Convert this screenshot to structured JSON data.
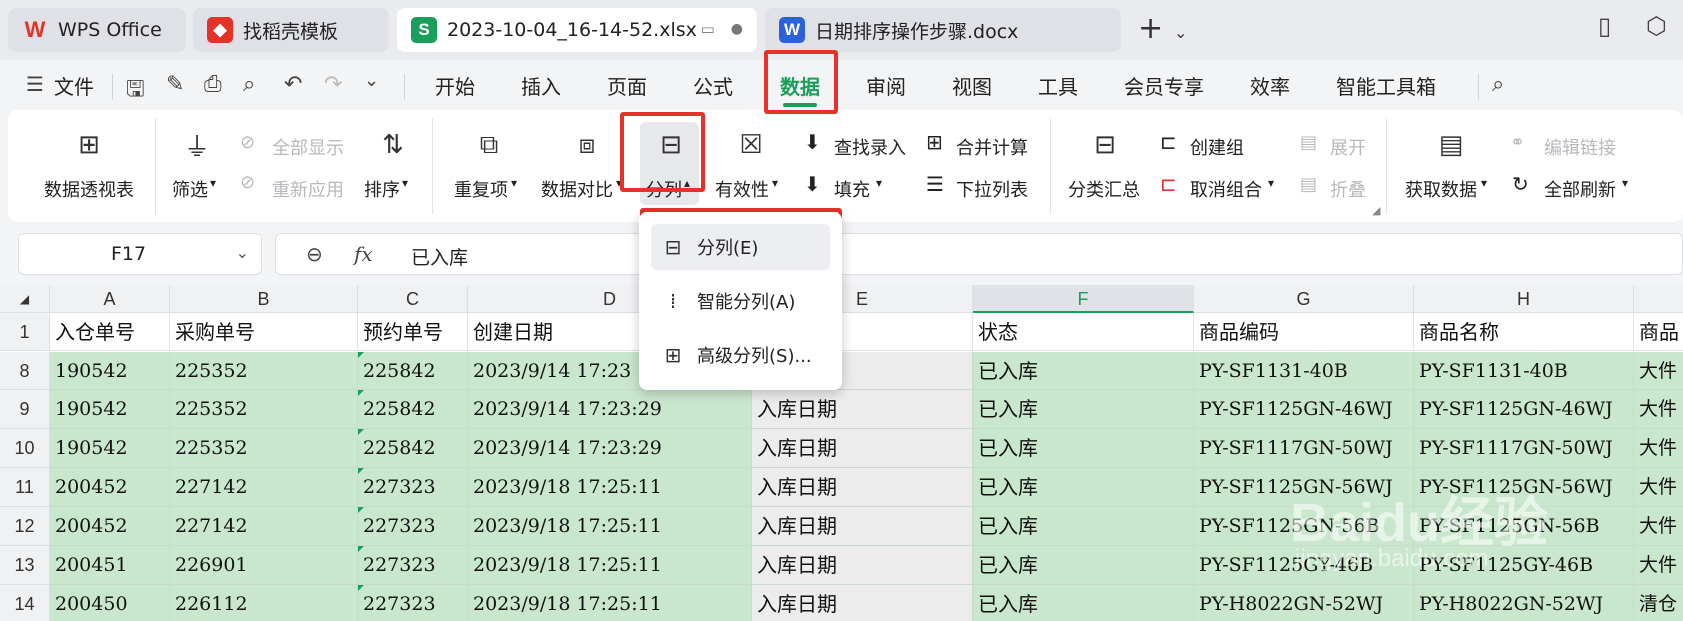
{
  "tabs": [
    {
      "label": "WPS Office",
      "icon": "wps-logo-icon"
    },
    {
      "label": "找稻壳模板",
      "icon": "docer-icon"
    },
    {
      "label": "2023-10-04_16-14-52.xlsx",
      "icon": "spreadsheet-icon",
      "icon_text": "S"
    },
    {
      "label": "日期排序操作步骤.docx",
      "icon": "writer-icon",
      "icon_text": "W"
    }
  ],
  "menu": {
    "file": "文件",
    "items": [
      "开始",
      "插入",
      "页面",
      "公式",
      "数据",
      "审阅",
      "视图",
      "工具",
      "会员专享",
      "效率",
      "智能工具箱"
    ],
    "active": "数据"
  },
  "ribbon": {
    "pivot": "数据透视表",
    "filter": "筛选",
    "show_all": "全部显示",
    "reapply": "重新应用",
    "sort": "排序",
    "duplicates": "重复项",
    "compare": "数据对比",
    "split": "分列",
    "validity": "有效性",
    "lookup": "查找录入",
    "fill": "填充",
    "consolidate": "合并计算",
    "dropdown_list": "下拉列表",
    "subtotal": "分类汇总",
    "create_group": "创建组",
    "ungroup": "取消组合",
    "expand": "展开",
    "collapse": "折叠",
    "get_data": "获取数据",
    "edit_links": "编辑链接",
    "refresh_all": "全部刷新"
  },
  "split_menu": [
    "分列(E)",
    "智能分列(A)",
    "高级分列(S)..."
  ],
  "formula_bar": {
    "cell_ref": "F17",
    "fx": "fx",
    "value": "已入库"
  },
  "columns": [
    "A",
    "B",
    "C",
    "D",
    "E",
    "F",
    "G",
    "H"
  ],
  "header_row": {
    "num": "1",
    "cells": [
      "入仓单号",
      "采购单号",
      "预约单号",
      "创建日期",
      "",
      "状态",
      "商品编码",
      "商品名称",
      "商品"
    ]
  },
  "rows": [
    {
      "num": "8",
      "cells": [
        "190542",
        "225352",
        "225842",
        "2023/9/14 17:23",
        "",
        "已入库",
        "PY-SF1131-40B",
        "PY-SF1131-40B",
        "大件"
      ]
    },
    {
      "num": "9",
      "cells": [
        "190542",
        "225352",
        "225842",
        "2023/9/14 17:23:29",
        "入库日期",
        "已入库",
        "PY-SF1125GN-46WJ",
        "PY-SF1125GN-46WJ",
        "大件"
      ]
    },
    {
      "num": "10",
      "cells": [
        "190542",
        "225352",
        "225842",
        "2023/9/14 17:23:29",
        "入库日期",
        "已入库",
        "PY-SF1117GN-50WJ",
        "PY-SF1117GN-50WJ",
        "大件"
      ]
    },
    {
      "num": "11",
      "cells": [
        "200452",
        "227142",
        "227323",
        "2023/9/18 17:25:11",
        "入库日期",
        "已入库",
        "PY-SF1125GN-56WJ",
        "PY-SF1125GN-56WJ",
        "大件"
      ]
    },
    {
      "num": "12",
      "cells": [
        "200452",
        "227142",
        "227323",
        "2023/9/18 17:25:11",
        "入库日期",
        "已入库",
        "PY-SF1125GN-56B",
        "PY-SF1125GN-56B",
        "大件"
      ]
    },
    {
      "num": "13",
      "cells": [
        "200451",
        "226901",
        "227323",
        "2023/9/18 17:25:11",
        "入库日期",
        "已入库",
        "PY-SF1125GY-46B",
        "PY-SF1125GY-46B",
        "大件"
      ]
    },
    {
      "num": "14",
      "cells": [
        "200450",
        "226112",
        "227323",
        "2023/9/18 17:25:11",
        "入库日期",
        "已入库",
        "PY-H8022GN-52WJ",
        "PY-H8022GN-52WJ",
        "清仓"
      ]
    }
  ],
  "watermark": {
    "brand": "Baidu经验",
    "url": "jingyan.baidu.com"
  },
  "colors": {
    "accent": "#1a9e5b",
    "highlight_red": "#e5332a",
    "cell_green": "#c9e7cc"
  }
}
